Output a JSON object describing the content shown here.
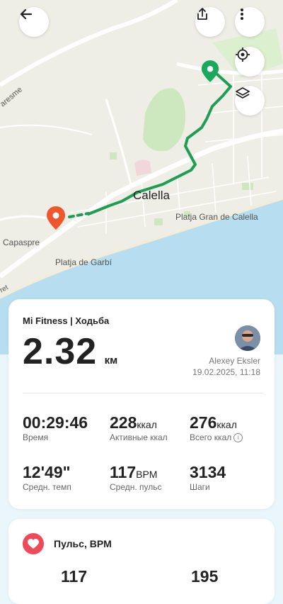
{
  "map": {
    "city_label": "Calella",
    "beach1_label": "Platja Gran de Calella",
    "beach2_label": "Platja de Garbí",
    "place_label": "l Capaspre",
    "road1_label": "aresme",
    "road2_label": "ret"
  },
  "toolbar": {
    "back_icon": "arrow-left-icon",
    "share_icon": "share-icon",
    "more_icon": "more-vertical-icon",
    "locate_icon": "crosshair-icon",
    "layers_icon": "layers-icon"
  },
  "summary": {
    "source": "Mi Fitness | Ходьба",
    "distance": "2.32",
    "distance_unit": "км",
    "user_name": "Alexey Eksler",
    "datetime": "19.02.2025, 11:18"
  },
  "stats": [
    {
      "value": "00:29:46",
      "unit": "",
      "label": "Время"
    },
    {
      "value": "228",
      "unit": "ккал",
      "label": "Активные ккал"
    },
    {
      "value": "276",
      "unit": "ккал",
      "label": "Всего ккал"
    },
    {
      "value": "12'49\"",
      "unit": "",
      "label": "Средн. темп"
    },
    {
      "value": "117",
      "unit": "BPM",
      "label": "Средн. пульс"
    },
    {
      "value": "3134",
      "unit": "",
      "label": "Шаги"
    }
  ],
  "heart": {
    "title": "Пульс, BPM",
    "value1": "117",
    "value2": "195"
  },
  "colors": {
    "route": "#1f9d55",
    "start_pin": "#f0562b",
    "end_pin": "#1aa85c",
    "sea": "#b7def0",
    "heart": "#f04a5a"
  }
}
